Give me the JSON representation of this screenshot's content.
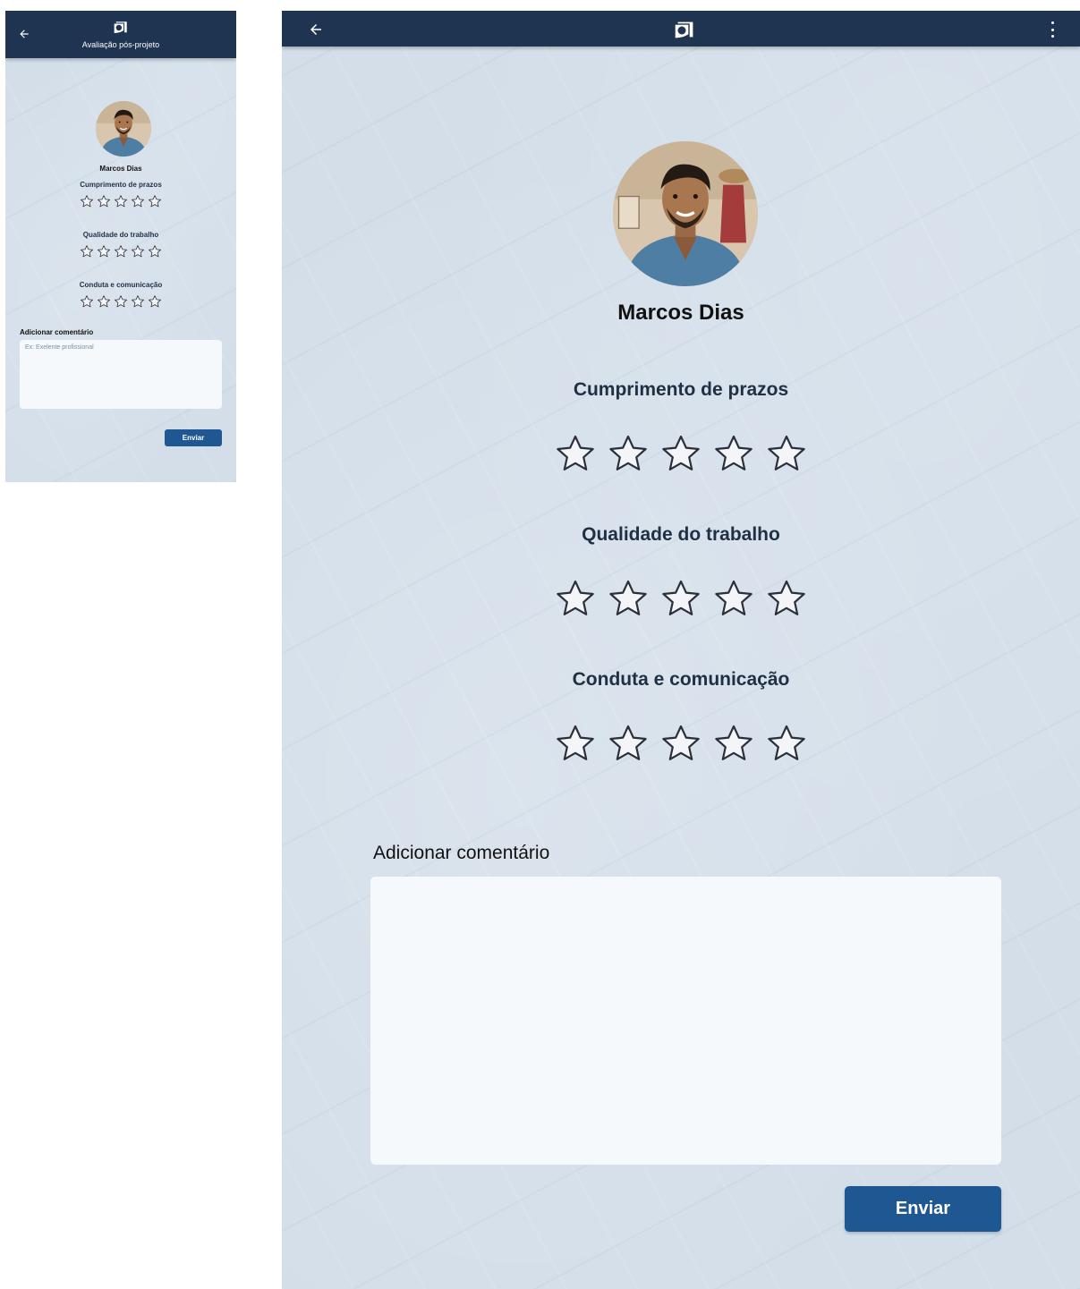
{
  "app": {
    "title": "Avaliação pós-projeto",
    "icons": {
      "back": "arrow-left-icon",
      "logo": "comic-book-logo-icon",
      "menu": "more-vertical-icon",
      "star": "star-outline-icon"
    },
    "colors": {
      "appbar": "#1e3450",
      "background": "#d3dee9",
      "accent": "#1f5792",
      "star_fill": "#f3f5f9",
      "star_stroke": "#2b2f3a"
    }
  },
  "profile": {
    "name": "Marcos Dias"
  },
  "criteria": [
    {
      "label": "Cumprimento de prazos",
      "rating": 0,
      "max": 5
    },
    {
      "label": "Qualidade do trabalho",
      "rating": 0,
      "max": 5
    },
    {
      "label": "Conduta e comunicação",
      "rating": 0,
      "max": 5
    }
  ],
  "comment": {
    "label": "Adicionar comentário",
    "placeholder": "Ex: Exelente profissional",
    "value": ""
  },
  "actions": {
    "submit_label": "Enviar"
  }
}
